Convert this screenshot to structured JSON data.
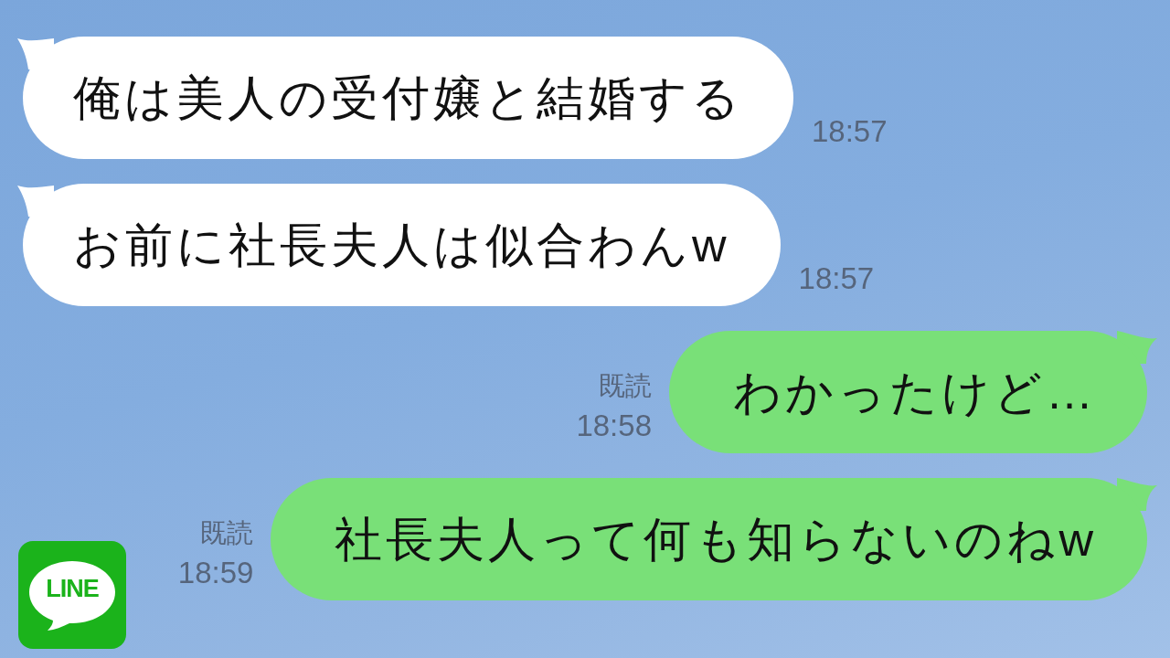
{
  "messages": [
    {
      "kind": "received",
      "text": "俺は美人の受付嬢と結婚する",
      "time": "18:57"
    },
    {
      "kind": "received",
      "text": "お前に社長夫人は似合わんw",
      "time": "18:57"
    },
    {
      "kind": "sent",
      "read_label": "既読",
      "text": "わかったけど…",
      "time": "18:58"
    },
    {
      "kind": "sent",
      "read_label": "既読",
      "text": "社長夫人って何も知らないのねw",
      "time": "18:59"
    }
  ],
  "logo": {
    "text": "LINE"
  }
}
